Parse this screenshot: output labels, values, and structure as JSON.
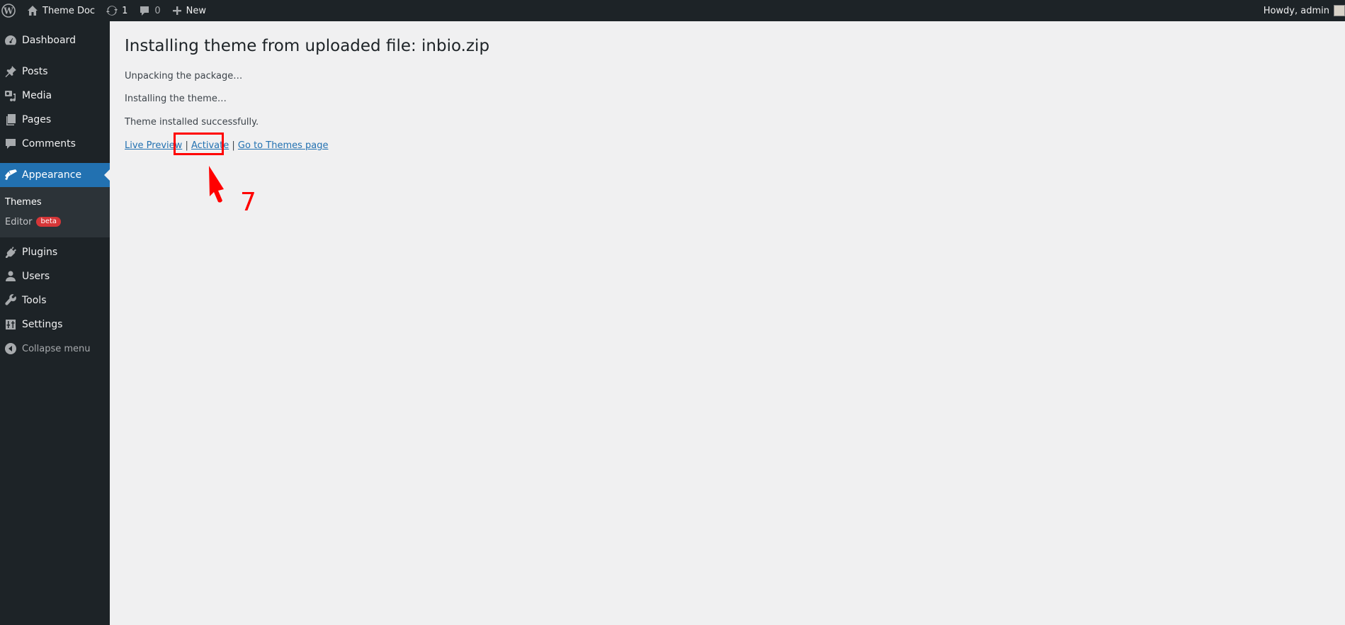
{
  "adminbar": {
    "site_name": "Theme Doc",
    "updates_count": "1",
    "comments_count": "0",
    "new_label": "New",
    "greeting": "Howdy, admin"
  },
  "sidebar": {
    "items": [
      {
        "label": "Dashboard",
        "icon": "dashboard-icon"
      },
      {
        "label": "Posts",
        "icon": "pin-icon"
      },
      {
        "label": "Media",
        "icon": "media-icon"
      },
      {
        "label": "Pages",
        "icon": "pages-icon"
      },
      {
        "label": "Comments",
        "icon": "comment-icon"
      },
      {
        "label": "Appearance",
        "icon": "brush-icon",
        "current": true
      },
      {
        "label": "Plugins",
        "icon": "plug-icon"
      },
      {
        "label": "Users",
        "icon": "user-icon"
      },
      {
        "label": "Tools",
        "icon": "wrench-icon"
      },
      {
        "label": "Settings",
        "icon": "sliders-icon"
      }
    ],
    "submenu": [
      {
        "label": "Themes"
      },
      {
        "label": "Editor",
        "badge": "beta"
      }
    ],
    "collapse_label": "Collapse menu"
  },
  "main": {
    "title": "Installing theme from uploaded file: inbio.zip",
    "messages": [
      "Unpacking the package…",
      "Installing the theme…",
      "Theme installed successfully."
    ],
    "actions": {
      "live_preview": "Live Preview",
      "activate": "Activate",
      "themes_page": "Go to Themes page",
      "separator": "|"
    }
  },
  "annotation": {
    "step_number": "7",
    "color": "#ff0000"
  }
}
